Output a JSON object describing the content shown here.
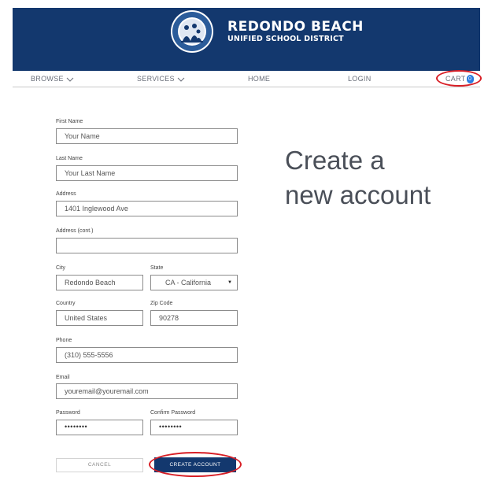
{
  "header": {
    "brand_line1": "REDONDO BEACH",
    "brand_line2": "UNIFIED SCHOOL DISTRICT",
    "bg_color": "#13386e"
  },
  "nav": {
    "browse": "BROWSE",
    "services": "SERVICES",
    "home": "HOME",
    "login": "LOGIN",
    "cart": "CART",
    "cart_count": "0"
  },
  "page_title": {
    "line1": "Create a",
    "line2": "new account"
  },
  "form": {
    "first_name": {
      "label": "First Name",
      "value": "Your Name"
    },
    "last_name": {
      "label": "Last Name",
      "value": "Your Last Name"
    },
    "address": {
      "label": "Address",
      "value": "1401 Inglewood Ave"
    },
    "address_cont": {
      "label": "Address (cont.)",
      "value": ""
    },
    "city": {
      "label": "City",
      "value": "Redondo Beach"
    },
    "state": {
      "label": "State",
      "value": "CA - California"
    },
    "country": {
      "label": "Country",
      "value": "United States"
    },
    "zip": {
      "label": "Zip Code",
      "value": "90278"
    },
    "phone": {
      "label": "Phone",
      "value": "(310) 555-5556"
    },
    "email": {
      "label": "Email",
      "value": "youremail@youremail.com"
    },
    "password": {
      "label": "Password",
      "value": "••••••••"
    },
    "confirm_password": {
      "label": "Confirm Password",
      "value": "••••••••"
    }
  },
  "buttons": {
    "cancel": "CANCEL",
    "create_account": "CREATE ACCOUNT"
  },
  "annotation_color": "#d81f26"
}
